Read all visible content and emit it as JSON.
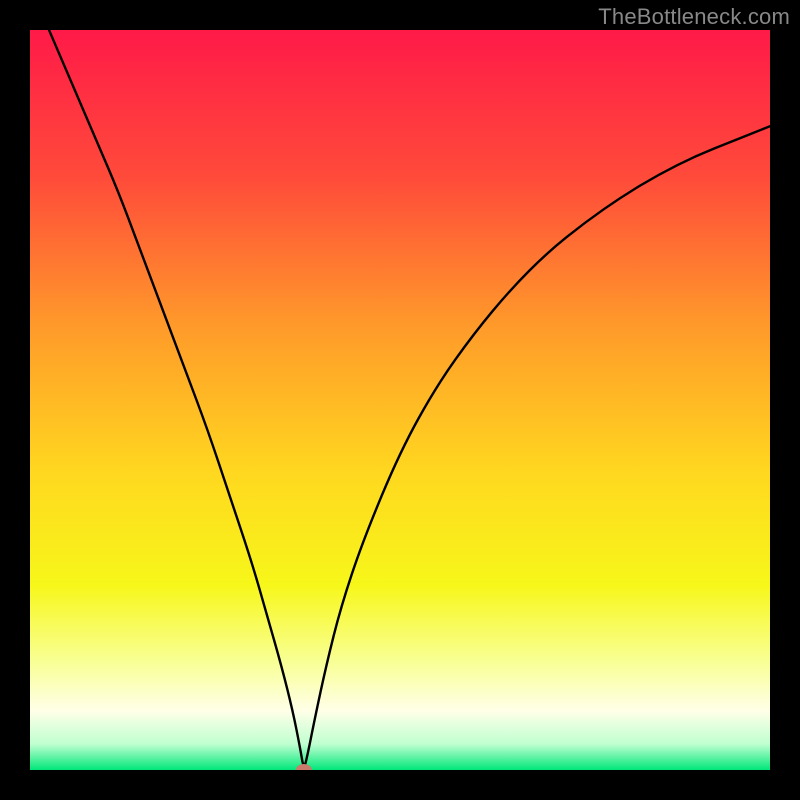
{
  "watermark": "TheBottleneck.com",
  "chart_data": {
    "type": "line",
    "title": "",
    "xlabel": "",
    "ylabel": "",
    "xlim": [
      0,
      100
    ],
    "ylim": [
      0,
      100
    ],
    "grid": false,
    "legend": false,
    "background_gradient_stops": [
      {
        "offset": 0.0,
        "color": "#ff1a48"
      },
      {
        "offset": 0.2,
        "color": "#ff4b3a"
      },
      {
        "offset": 0.4,
        "color": "#ff9a2a"
      },
      {
        "offset": 0.6,
        "color": "#ffd81f"
      },
      {
        "offset": 0.75,
        "color": "#f7f71a"
      },
      {
        "offset": 0.85,
        "color": "#f8ff90"
      },
      {
        "offset": 0.92,
        "color": "#ffffe8"
      },
      {
        "offset": 0.965,
        "color": "#bfffd0"
      },
      {
        "offset": 1.0,
        "color": "#00e77a"
      }
    ],
    "minimum_marker": {
      "x": 37,
      "y": 0,
      "color": "#c97a6b",
      "rx": 8,
      "ry": 6
    },
    "series": [
      {
        "name": "curve",
        "x": [
          0,
          3,
          6,
          9,
          12,
          15,
          18,
          21,
          24,
          27,
          30,
          32,
          34,
          35.5,
          36.5,
          37,
          37.5,
          38.5,
          40,
          42,
          45,
          50,
          55,
          60,
          65,
          70,
          75,
          80,
          85,
          90,
          95,
          100
        ],
        "y": [
          106,
          99,
          92,
          85,
          78,
          70,
          62,
          54,
          46,
          37,
          28,
          21,
          14,
          8,
          3,
          0,
          2,
          7,
          14,
          22,
          31,
          43,
          52,
          59,
          65,
          70,
          74,
          77.5,
          80.5,
          83,
          85,
          87
        ]
      }
    ]
  }
}
